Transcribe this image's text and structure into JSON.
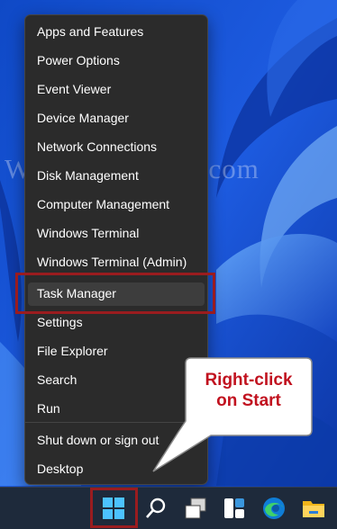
{
  "watermark": "WindowsDigital.com",
  "menu": {
    "items": [
      "Apps and Features",
      "Power Options",
      "Event Viewer",
      "Device Manager",
      "Network Connections",
      "Disk Management",
      "Computer Management",
      "Windows Terminal",
      "Windows Terminal (Admin)",
      "Task Manager",
      "Settings",
      "File Explorer",
      "Search",
      "Run",
      "Shut down or sign out",
      "Desktop"
    ],
    "highlighted": "Task Manager"
  },
  "callout": {
    "line1": "Right-click",
    "line2": "on Start"
  },
  "taskbar": {
    "icons": [
      "start-icon",
      "search-icon",
      "task-view-icon",
      "widgets-icon",
      "edge-icon",
      "file-explorer-icon"
    ]
  },
  "colors": {
    "annotation_red": "#9a1c1f",
    "menu_bg": "#2b2b2b",
    "wallpaper_blue": "#1a4fc9"
  }
}
